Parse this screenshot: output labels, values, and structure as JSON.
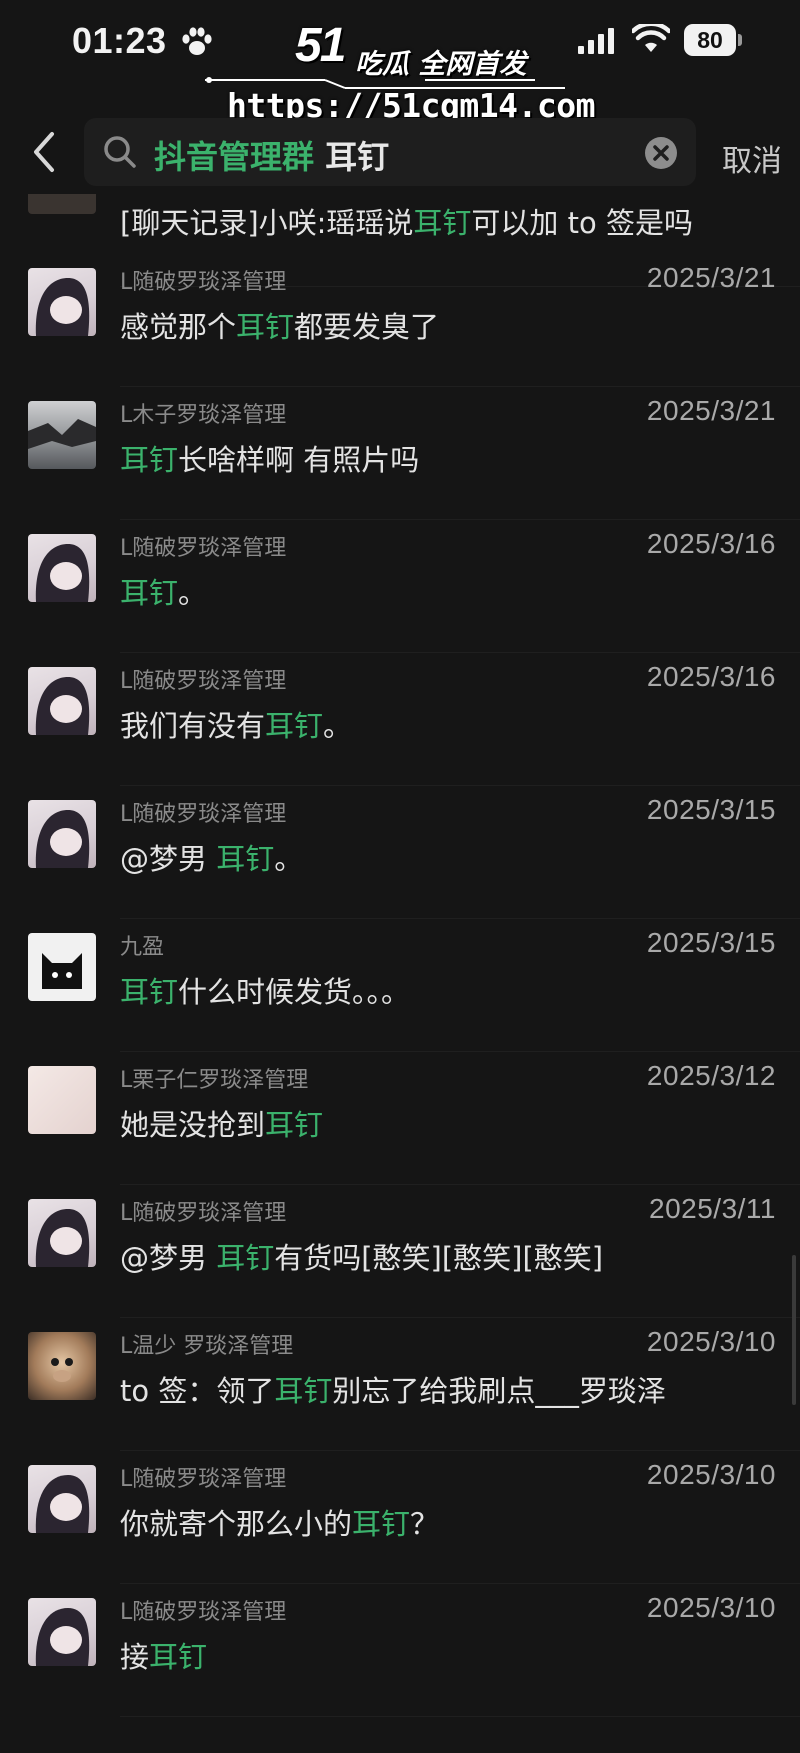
{
  "status_bar": {
    "time": "01:23",
    "battery": "80"
  },
  "watermark": {
    "logo_number": "51",
    "brand": "吃瓜 全网首发",
    "url": "https://51cgm14.com"
  },
  "search": {
    "group_name": "抖音管理群",
    "term": "耳钉",
    "cancel_label": "取消"
  },
  "colors": {
    "highlight": "#3bb26c",
    "background": "#151515"
  },
  "partial_item": {
    "message": {
      "before": "[聊天记录]小咲:瑶瑶说",
      "keyword": "耳钉",
      "after": "可以加 to 签是吗"
    }
  },
  "results": [
    {
      "avatar": "anime-girl-avatar",
      "sender": "L随破罗琰泽管理",
      "date": "2025/3/21",
      "message": {
        "before": "感觉那个",
        "keyword": "耳钉",
        "after": "都要发臭了"
      }
    },
    {
      "avatar": "tree-photo-avatar",
      "sender": "L木子罗琰泽管理",
      "date": "2025/3/21",
      "message": {
        "before": "",
        "keyword": "耳钉",
        "after": "长啥样啊 有照片吗"
      }
    },
    {
      "avatar": "anime-girl-avatar",
      "sender": "L随破罗琰泽管理",
      "date": "2025/3/16",
      "message": {
        "before": "",
        "keyword": "耳钉",
        "after": "。"
      }
    },
    {
      "avatar": "anime-girl-avatar",
      "sender": "L随破罗琰泽管理",
      "date": "2025/3/16",
      "message": {
        "before": "我们有没有",
        "keyword": "耳钉",
        "after": "。"
      }
    },
    {
      "avatar": "anime-girl-avatar",
      "sender": "L随破罗琰泽管理",
      "date": "2025/3/15",
      "message": {
        "before": "@梦男 ",
        "keyword": "耳钉",
        "after": "。"
      }
    },
    {
      "avatar": "black-cat-avatar",
      "sender": "九盈",
      "date": "2025/3/15",
      "message": {
        "before": "",
        "keyword": "耳钉",
        "after": "什么时候发货。。。"
      }
    },
    {
      "avatar": "blank-pink-avatar",
      "sender": "L栗子仁罗琰泽管理",
      "date": "2025/3/12",
      "message": {
        "before": "她是没抢到",
        "keyword": "耳钉",
        "after": ""
      }
    },
    {
      "avatar": "anime-girl-avatar",
      "sender": "L随破罗琰泽管理",
      "date": "2025/3/11",
      "message": {
        "before": "@梦男 ",
        "keyword": "耳钉",
        "after": "有货吗[憨笑][憨笑][憨笑]"
      }
    },
    {
      "avatar": "monkey-photo-avatar",
      "sender": "L温少 罗琰泽管理",
      "date": "2025/3/10",
      "message": {
        "before": "to 签：领了",
        "keyword": "耳钉",
        "after": "别忘了给我刷点___罗琰泽"
      }
    },
    {
      "avatar": "anime-girl-avatar",
      "sender": "L随破罗琰泽管理",
      "date": "2025/3/10",
      "message": {
        "before": "你就寄个那么小的",
        "keyword": "耳钉",
        "after": "？"
      }
    },
    {
      "avatar": "anime-girl-avatar",
      "sender": "L随破罗琰泽管理",
      "date": "2025/3/10",
      "message": {
        "before": "接",
        "keyword": "耳钉",
        "after": ""
      }
    }
  ]
}
